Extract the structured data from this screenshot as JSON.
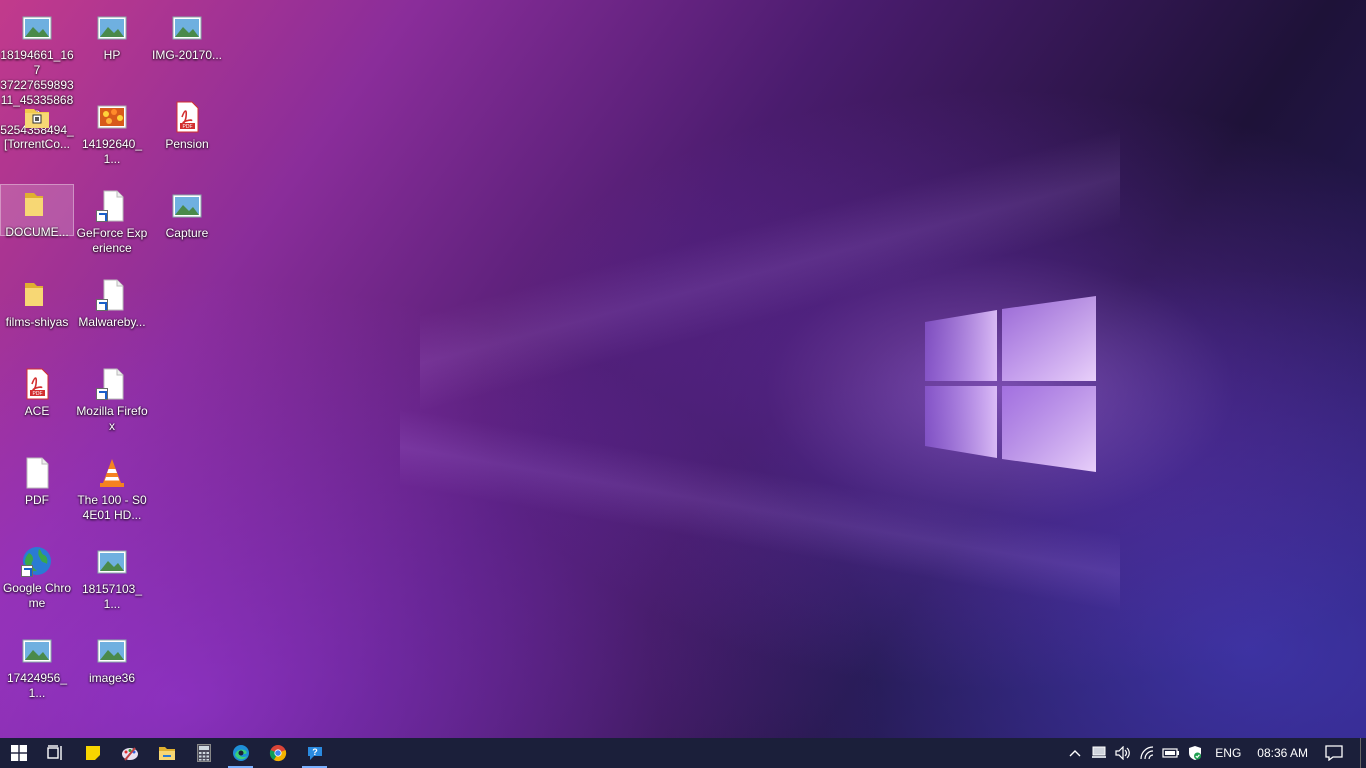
{
  "desktop": {
    "icons": [
      {
        "label": "18194661_167\n37227659893\n11_453358683\n5254358494_",
        "type": "image"
      },
      {
        "label": "HP",
        "type": "image"
      },
      {
        "label": "IMG-20170...",
        "type": "image"
      },
      {
        "label": "[TorrentCo...",
        "type": "folder-locked"
      },
      {
        "label": "14192640_1...",
        "type": "photo-flowers"
      },
      {
        "label": "Pension",
        "type": "pdf"
      },
      {
        "label": "DOCUME...",
        "type": "folder"
      },
      {
        "label": "GeForce Experience",
        "type": "file-shortcut"
      },
      {
        "label": "Capture",
        "type": "image"
      },
      {
        "label": "films-shiyas",
        "type": "folder"
      },
      {
        "label": "Malwareby...",
        "type": "file-shortcut"
      },
      {
        "label": "ACE",
        "type": "pdf"
      },
      {
        "label": "Mozilla Firefox",
        "type": "file-shortcut"
      },
      {
        "label": "PDF",
        "type": "blank-file"
      },
      {
        "label": "The 100 - S04E01 HD...",
        "type": "vlc"
      },
      {
        "label": "Google Chrome",
        "type": "globe-shortcut"
      },
      {
        "label": "18157103_1...",
        "type": "image"
      },
      {
        "label": "17424956_1...",
        "type": "image"
      },
      {
        "label": "image36",
        "type": "image"
      }
    ]
  },
  "taskbar": {
    "apps": [
      {
        "name": "start-button-icon"
      },
      {
        "name": "task-view-icon"
      },
      {
        "name": "sticky-notes-icon"
      },
      {
        "name": "paint-icon"
      },
      {
        "name": "file-explorer-icon"
      },
      {
        "name": "calculator-icon"
      },
      {
        "name": "edge-icon"
      },
      {
        "name": "chrome-icon"
      },
      {
        "name": "help-icon"
      }
    ],
    "tray": {
      "language": "ENG",
      "time": "08:36 AM"
    }
  },
  "pdf_badge": "PDF",
  "colors": {
    "taskbar": "#1b1f3a",
    "folder": "#f2c94c",
    "pdf_red": "#d32f2f"
  }
}
